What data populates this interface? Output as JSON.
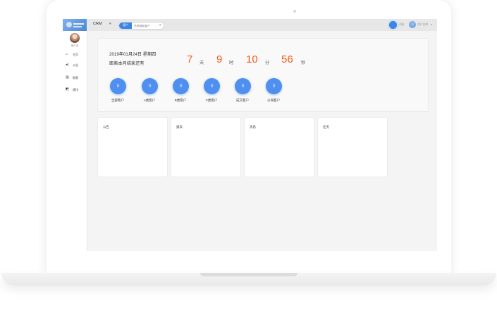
{
  "topbar": {
    "app_name": "CRM",
    "search_category": "客户",
    "search_placeholder": "名称搜索客户",
    "right_label_1": "消息",
    "user_name": "用户名称"
  },
  "sidebar": {
    "user_label": "用户名",
    "items": [
      {
        "label": "主页",
        "icon": "home-icon"
      },
      {
        "label": "公告",
        "icon": "announcement-icon"
      },
      {
        "label": "报表",
        "icon": "report-icon"
      },
      {
        "label": "通讯",
        "icon": "contact-icon"
      }
    ]
  },
  "summary": {
    "date_line": "2019年01月24日 星期四",
    "remaining_line": "距离本月结束还有",
    "countdown": {
      "days": "7",
      "days_unit": "天",
      "hours": "9",
      "hours_unit": "时",
      "minutes": "10",
      "minutes_unit": "分",
      "seconds": "56",
      "seconds_unit": "秒"
    },
    "stats": [
      {
        "value": "0",
        "label": "全部客户"
      },
      {
        "value": "0",
        "label": "A类客户"
      },
      {
        "value": "0",
        "label": "B类客户"
      },
      {
        "value": "0",
        "label": "C类客户"
      },
      {
        "value": "0",
        "label": "成交客户"
      },
      {
        "value": "0",
        "label": "公海客户"
      }
    ]
  },
  "panels": [
    {
      "title": "公告"
    },
    {
      "title": "报表"
    },
    {
      "title": "消息"
    },
    {
      "title": "任务"
    }
  ],
  "colors": {
    "accent": "#3a86e6",
    "stat_circle": "#4f8ff0",
    "countdown": "#f25a1a"
  }
}
